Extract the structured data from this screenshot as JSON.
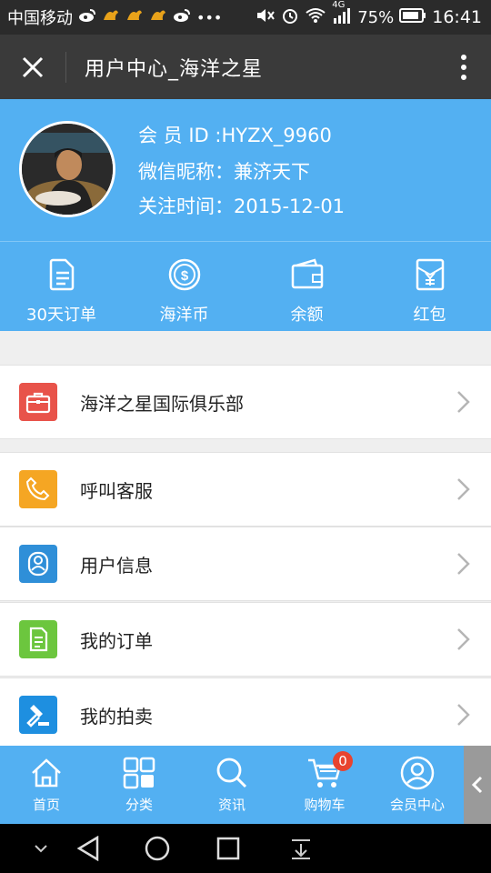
{
  "status_bar": {
    "carrier": "中国移动",
    "battery_percent": "75%",
    "time": "16:41",
    "network": "4G",
    "icons": [
      "weibo-icon",
      "bird-icon",
      "bird-icon",
      "bird-icon",
      "weibo-icon",
      "more-dots-icon",
      "mute-icon",
      "alarm-icon",
      "wifi-icon",
      "signal-icon",
      "battery-icon"
    ]
  },
  "title_bar": {
    "title": "用户中心_海洋之星",
    "close_icon": "close-icon",
    "more_icon": "more-vertical-icon"
  },
  "profile": {
    "member_id": "会 员 ID :HYZX_9960",
    "nickname": "微信昵称：兼济天下",
    "follow_time": "关注时间：2015-12-01"
  },
  "stats": [
    {
      "label": "30天订单",
      "icon": "document-icon"
    },
    {
      "label": "海洋币",
      "icon": "coin-icon"
    },
    {
      "label": "余额",
      "icon": "wallet-icon"
    },
    {
      "label": "红包",
      "icon": "yen-envelope-icon"
    }
  ],
  "menu": [
    {
      "label": "海洋之星国际俱乐部",
      "icon": "briefcase-icon",
      "color": "#e8534a"
    },
    {
      "label": "呼叫客服",
      "icon": "phone-icon",
      "color": "#f5a623"
    },
    {
      "label": "用户信息",
      "icon": "user-icon",
      "color": "#2f8fd8"
    },
    {
      "label": "我的订单",
      "icon": "document-icon",
      "color": "#6cc63e"
    },
    {
      "label": "我的拍卖",
      "icon": "gavel-icon",
      "color": "#1e8fe0"
    }
  ],
  "tabbar": [
    {
      "label": "首页",
      "icon": "home-icon"
    },
    {
      "label": "分类",
      "icon": "grid-icon"
    },
    {
      "label": "资讯",
      "icon": "search-icon"
    },
    {
      "label": "购物车",
      "icon": "cart-icon",
      "badge": "0"
    },
    {
      "label": "会员中心",
      "icon": "user-circle-icon"
    }
  ],
  "colors": {
    "accent": "#53b0f2",
    "titlebar": "#3a3a3a",
    "statusbar": "#2b2b2b",
    "badge": "#e8432f"
  }
}
